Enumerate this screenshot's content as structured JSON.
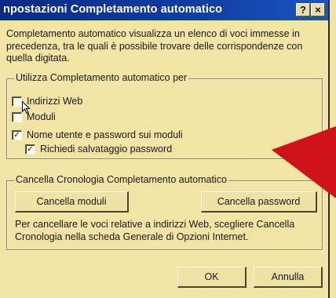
{
  "window": {
    "title": "npostazioni Completamento automatico",
    "help_label": "?",
    "close_label": "×"
  },
  "description": "Completamento automatico visualizza un elenco di voci immesse in precedenza, tra le quali è possibile trovare delle corrispondenze con quella digitata.",
  "use_group": {
    "legend": "Utilizza Completamento automatico per",
    "options": [
      {
        "label": "Indirizzi Web",
        "checked": false
      },
      {
        "label": "Moduli",
        "checked": false
      },
      {
        "label": "Nome utente e password sui moduli",
        "checked": true
      },
      {
        "label": "Richiedi salvataggio password",
        "checked": true
      }
    ]
  },
  "clear_group": {
    "legend": "Cancella Cronologia Completamento automatico",
    "clear_forms_label": "Cancella moduli",
    "clear_passwords_label": "Cancella password",
    "note": "Per cancellare le voci relative a indirizzi Web, scegliere Cancella Cronologia nella scheda Generale di Opzioni Internet."
  },
  "buttons": {
    "ok_label": "OK",
    "cancel_label": "Annulla"
  },
  "colors": {
    "background": "#f0e3a3",
    "titlebar": "#0f3ea3",
    "arrow": "#d0101b"
  }
}
